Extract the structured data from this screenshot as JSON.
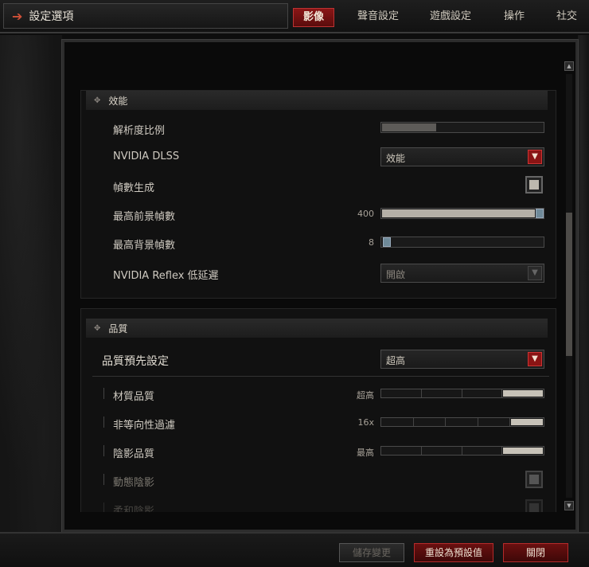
{
  "header": {
    "title": "設定選項",
    "tabs": [
      "影像",
      "聲音設定",
      "遊戲設定",
      "操作",
      "社交"
    ],
    "active_tab": "影像"
  },
  "performance": {
    "heading": "效能",
    "rows": [
      {
        "label": "解析度比例",
        "control": "slider",
        "value_text": "",
        "fill": 0.34
      },
      {
        "label": "NVIDIA DLSS",
        "control": "dropdown",
        "selected": "效能"
      },
      {
        "label": "幀數生成",
        "control": "checkbox",
        "checked": true
      },
      {
        "label": "最高前景幀數",
        "control": "slider",
        "value_text": "400",
        "fill": 1.0
      },
      {
        "label": "最高背景幀數",
        "control": "slider",
        "value_text": "8",
        "fill": 0.0
      },
      {
        "label": "NVIDIA Reflex 低延遲",
        "control": "dropdown",
        "selected": "開啟",
        "disabled": true
      }
    ]
  },
  "quality": {
    "heading": "品質",
    "preset_label": "品質預先設定",
    "preset_value": "超高",
    "rows": [
      {
        "label": "材質品質",
        "value_text": "超高",
        "segments": 4,
        "level": 4
      },
      {
        "label": "非等向性過濾",
        "value_text": "16x",
        "segments": 5,
        "level": 5
      },
      {
        "label": "陰影品質",
        "value_text": "最高",
        "segments": 4,
        "level": 4
      },
      {
        "label": "動態陰影",
        "control": "checkbox",
        "checked": true,
        "disabled": true
      },
      {
        "label": "柔和陰影",
        "control": "checkbox",
        "checked": true,
        "disabled": true
      }
    ]
  },
  "footer": {
    "save_label": "儲存變更",
    "reset_label": "重設為預設值",
    "close_label": "關閉"
  },
  "colors": {
    "accent_red": "#8a1414",
    "panel_bg": "#0a0a0a"
  }
}
